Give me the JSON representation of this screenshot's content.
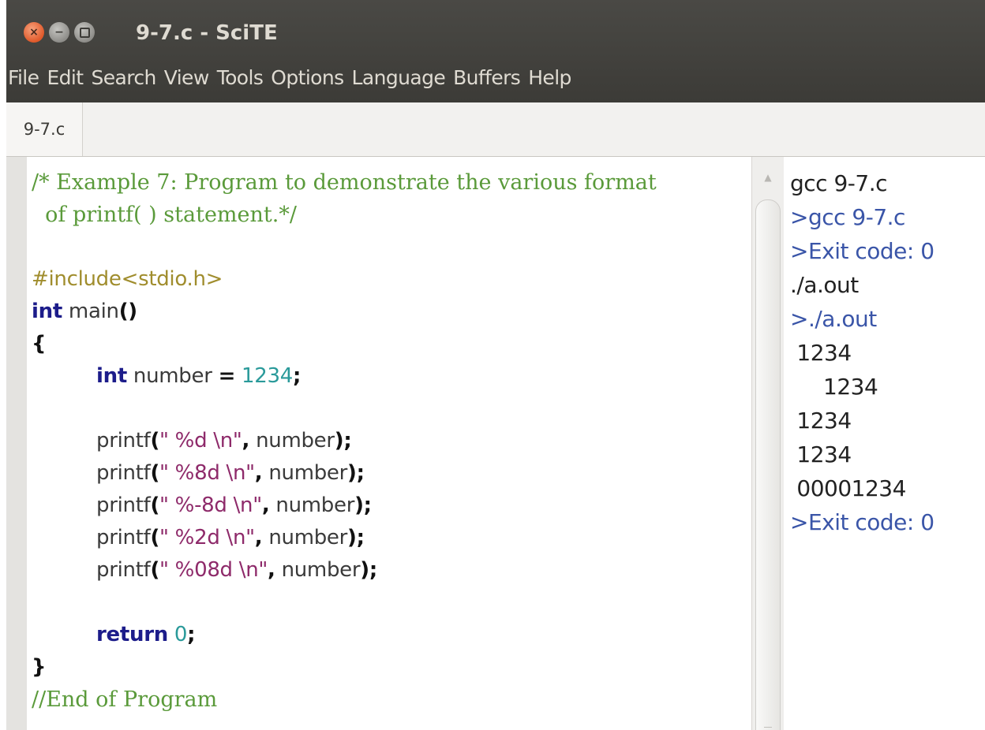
{
  "window": {
    "title": "9-7.c - SciTE",
    "buttons": {
      "close_glyph": "×",
      "minimize_glyph": "−"
    }
  },
  "menubar": {
    "items": [
      "File",
      "Edit",
      "Search",
      "View",
      "Tools",
      "Options",
      "Language",
      "Buffers",
      "Help"
    ]
  },
  "tabs": [
    {
      "label": "9-7.c",
      "active": true
    }
  ],
  "editor": {
    "comment_line1": "/* Example 7: Program to demonstrate the various format",
    "comment_line2": "  of printf( ) statement.*/",
    "include": "#include<stdio.h>",
    "kw_int": "int",
    "main_name": " main",
    "parens": "()",
    "open_brace": "{",
    "decl_name": " number ",
    "assign": "=",
    "decl_value": " 1234",
    "semicolon": ";",
    "printf_name": "printf",
    "open_paren": "(",
    "printf_args": [
      {
        "fmt": "\" %d \\n\"",
        "arg": " number"
      },
      {
        "fmt": "\" %8d \\n\"",
        "arg": " number"
      },
      {
        "fmt": "\" %-8d \\n\"",
        "arg": " number"
      },
      {
        "fmt": "\" %2d \\n\"",
        "arg": " number"
      },
      {
        "fmt": "\" %08d \\n\"",
        "arg": " number"
      }
    ],
    "comma": ",",
    "close_paren_semicolon": ");",
    "kw_return": "return",
    "return_value": " 0",
    "close_brace": "}",
    "end_comment": "//End of Program"
  },
  "output": {
    "lines": [
      {
        "text": "gcc 9-7.c",
        "kind": "command"
      },
      {
        "text": ">gcc 9-7.c",
        "kind": "info"
      },
      {
        "text": ">Exit code: 0",
        "kind": "info"
      },
      {
        "text": "./a.out",
        "kind": "command"
      },
      {
        "text": ">./a.out",
        "kind": "info"
      },
      {
        "text": " 1234",
        "kind": "output"
      },
      {
        "text": "     1234",
        "kind": "output"
      },
      {
        "text": " 1234",
        "kind": "output"
      },
      {
        "text": " 1234",
        "kind": "output"
      },
      {
        "text": " 00001234",
        "kind": "output"
      },
      {
        "text": ">Exit code: 0",
        "kind": "info"
      }
    ]
  },
  "colors": {
    "comment": "#5a9a3a",
    "preprocessor": "#a08d2d",
    "keyword": "#1c1c8a",
    "string": "#8e2a6a",
    "number": "#2a9a9a",
    "output_info": "#3a55a8",
    "titlebar": "#3c3b37"
  }
}
